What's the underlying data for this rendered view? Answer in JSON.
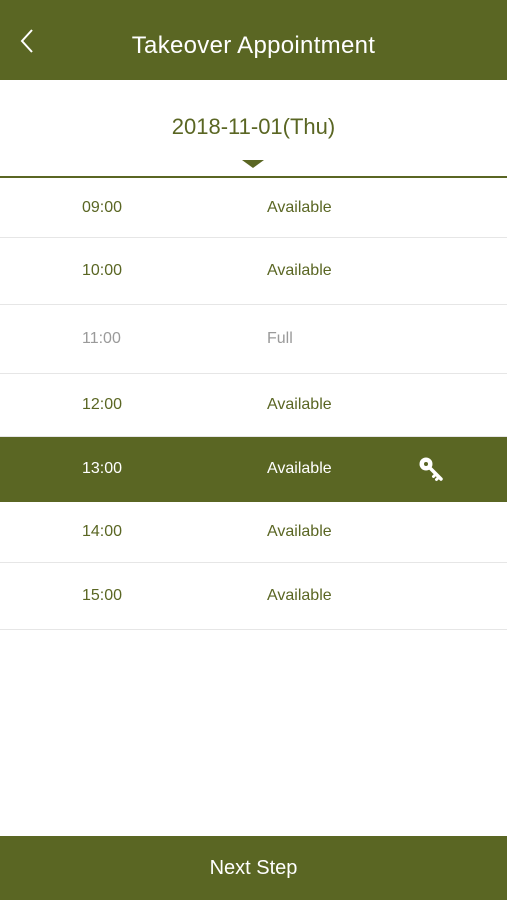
{
  "header": {
    "title": "Takeover Appointment",
    "back_icon": "chevron-left-icon"
  },
  "date_picker": {
    "value": "2018-11-01(Thu)",
    "caret_icon": "caret-down-icon"
  },
  "slots": [
    {
      "time": "09:00",
      "status": "Available"
    },
    {
      "time": "10:00",
      "status": "Available"
    },
    {
      "time": "11:00",
      "status": "Full"
    },
    {
      "time": "12:00",
      "status": "Available"
    },
    {
      "time": "13:00",
      "status": "Available",
      "selected_icon": "key-icon"
    },
    {
      "time": "14:00",
      "status": "Available"
    },
    {
      "time": "15:00",
      "status": "Available"
    }
  ],
  "footer": {
    "next_label": "Next Step"
  },
  "colors": {
    "brand": "#5a6623",
    "disabled_text": "#9a9a9a",
    "divider": "#e6e6e6"
  }
}
